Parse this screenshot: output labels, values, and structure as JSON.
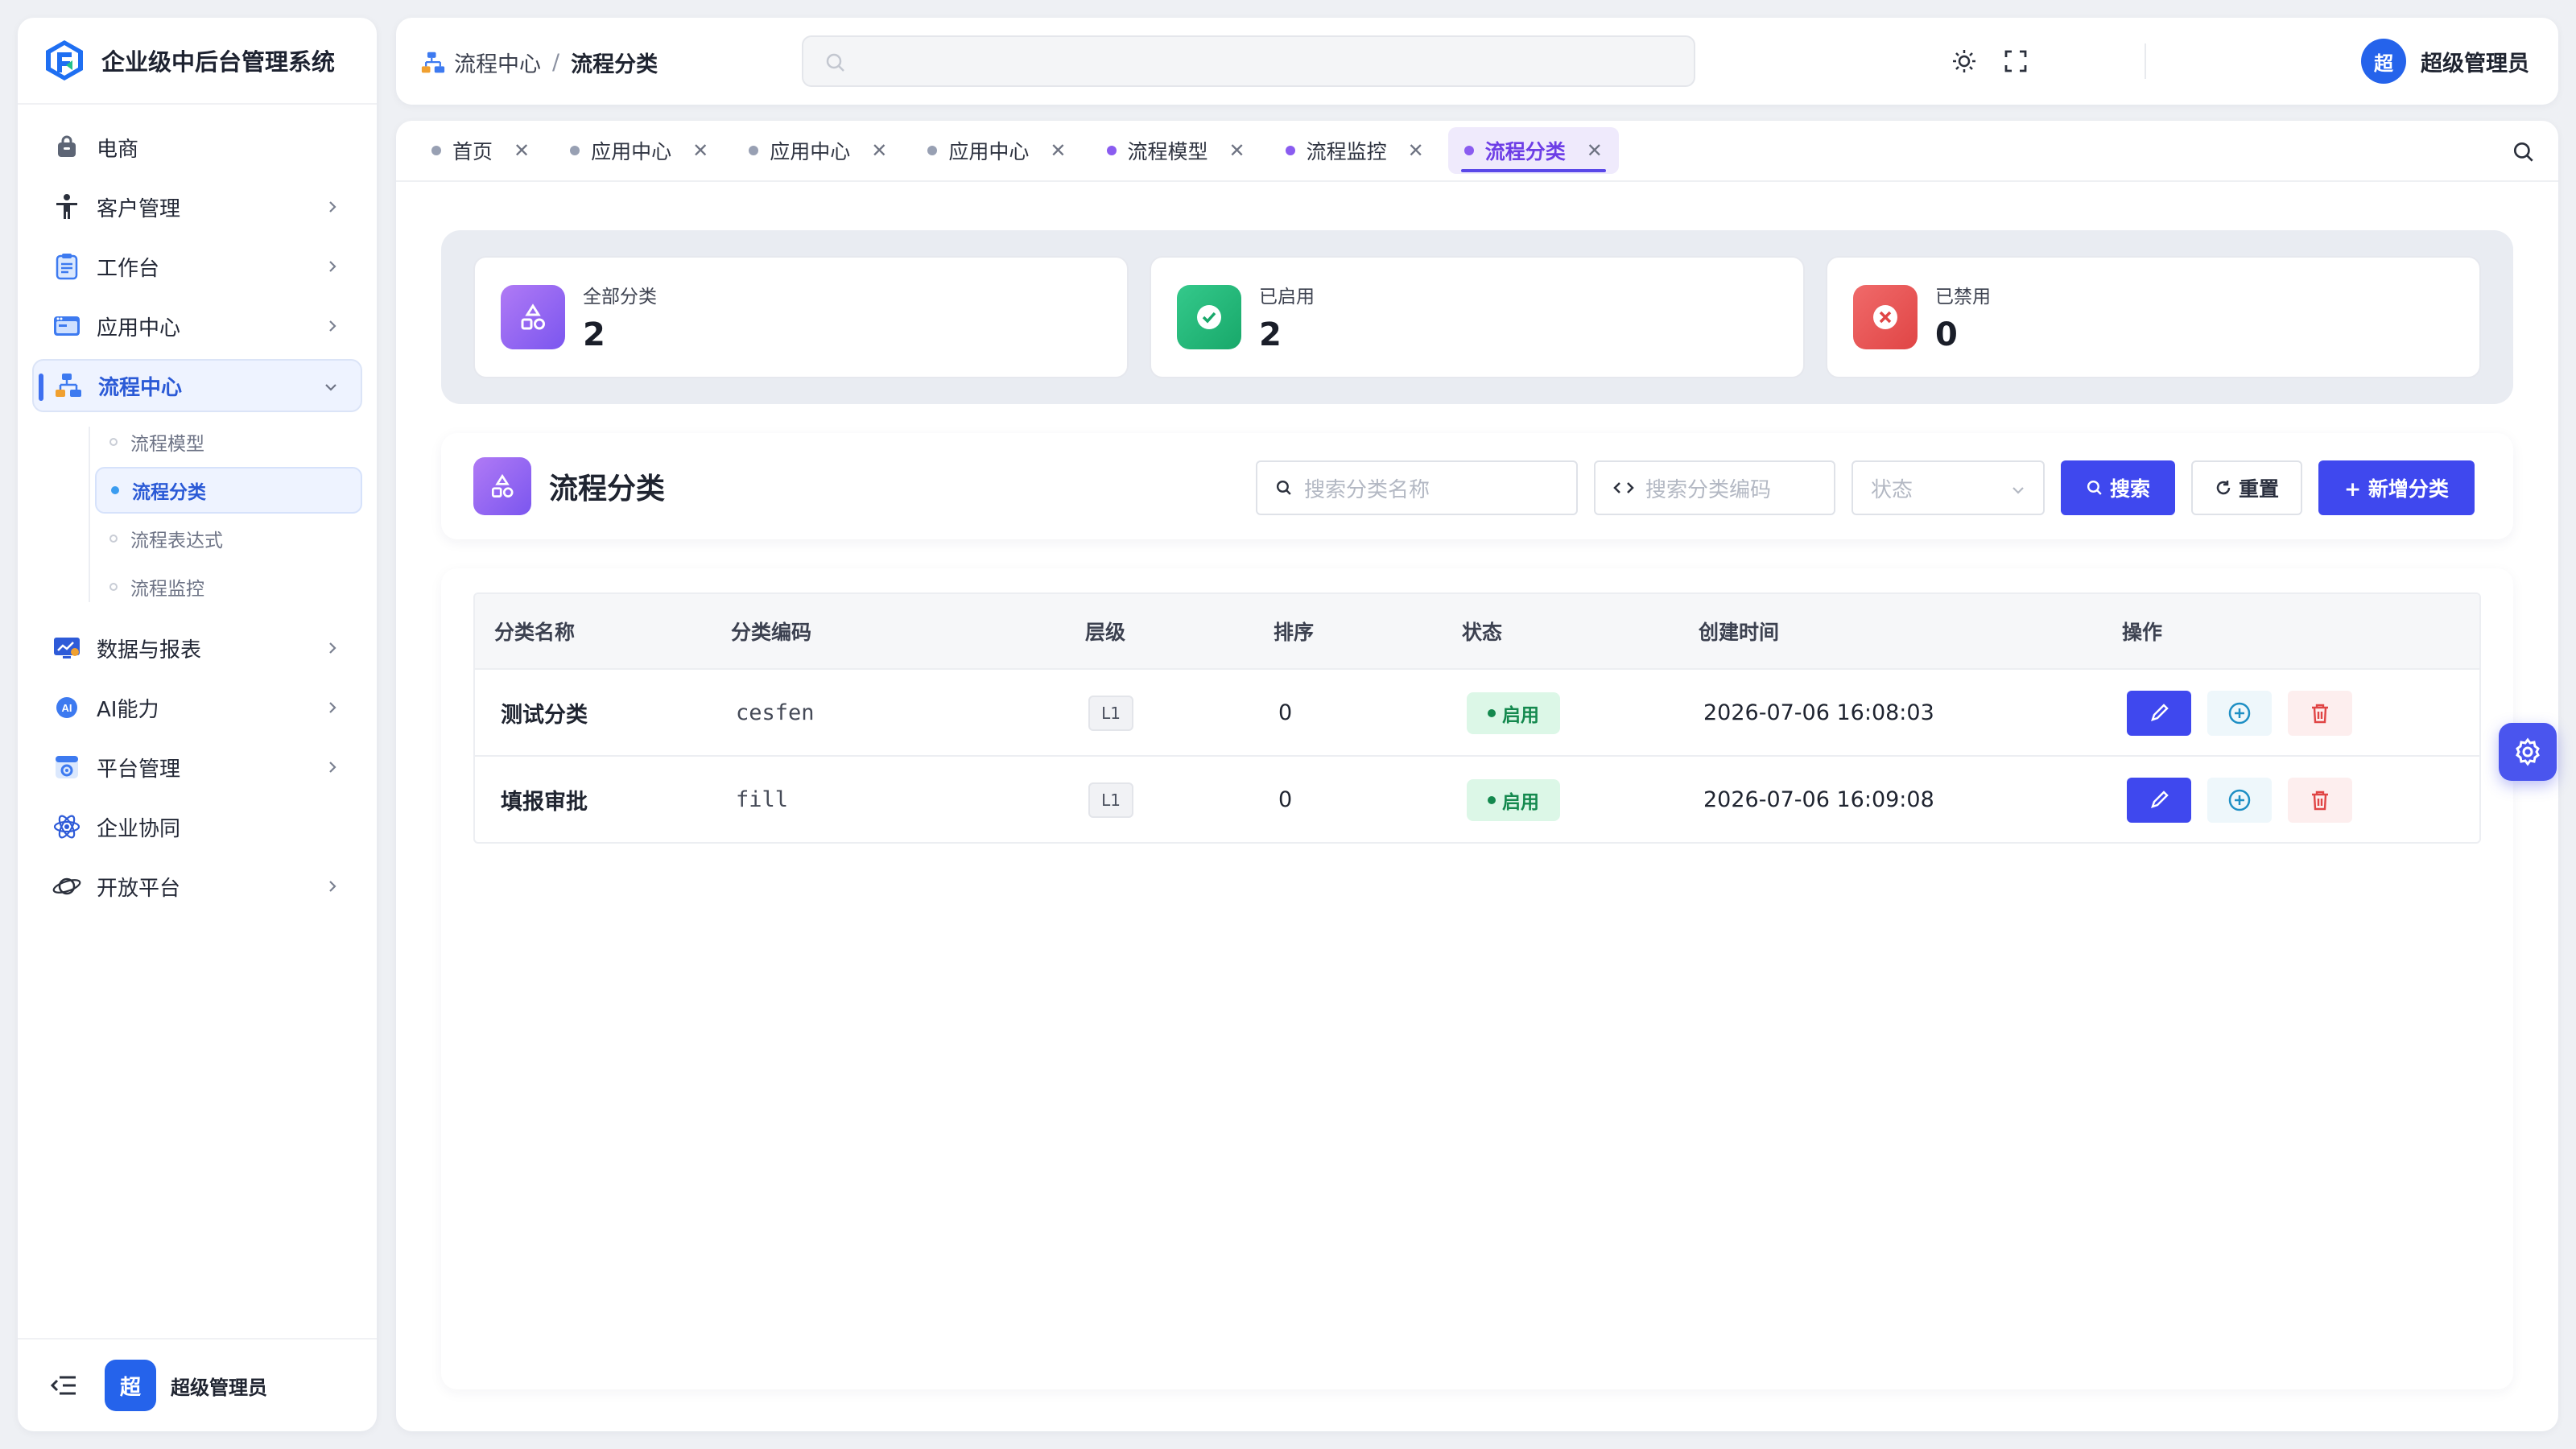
{
  "app": {
    "title": "企业级中后台管理系统"
  },
  "sidebar": {
    "items": [
      {
        "label": "电商",
        "icon": "shopping-bag-icon",
        "has_children": false
      },
      {
        "label": "客户管理",
        "icon": "person-icon",
        "has_children": true
      },
      {
        "label": "工作台",
        "icon": "clipboard-icon",
        "has_children": true
      },
      {
        "label": "应用中心",
        "icon": "app-window-icon",
        "has_children": true
      },
      {
        "label": "流程中心",
        "icon": "flow-icon",
        "has_children": true,
        "expanded": true,
        "active": true
      },
      {
        "label": "数据与报表",
        "icon": "chart-monitor-icon",
        "has_children": true
      },
      {
        "label": "AI能力",
        "icon": "ai-icon",
        "has_children": true
      },
      {
        "label": "平台管理",
        "icon": "platform-gear-icon",
        "has_children": true
      },
      {
        "label": "企业协同",
        "icon": "atom-icon",
        "has_children": false
      },
      {
        "label": "开放平台",
        "icon": "planet-icon",
        "has_children": true
      }
    ],
    "subitems": [
      {
        "label": "流程模型",
        "active": false
      },
      {
        "label": "流程分类",
        "active": true
      },
      {
        "label": "流程表达式",
        "active": false
      },
      {
        "label": "流程监控",
        "active": false
      }
    ],
    "footer": {
      "avatar_text": "超",
      "user_name": "超级管理员"
    }
  },
  "header": {
    "breadcrumb": {
      "parent": "流程中心",
      "separator": "/",
      "current": "流程分类"
    },
    "search_placeholder": "",
    "user": {
      "avatar_text": "超",
      "name": "超级管理员"
    }
  },
  "tabs": [
    {
      "label": "首页",
      "active": false,
      "dot": "gray"
    },
    {
      "label": "应用中心",
      "active": false,
      "dot": "gray"
    },
    {
      "label": "应用中心",
      "active": false,
      "dot": "gray"
    },
    {
      "label": "应用中心",
      "active": false,
      "dot": "gray"
    },
    {
      "label": "流程模型",
      "active": false,
      "dot": "purple"
    },
    {
      "label": "流程监控",
      "active": false,
      "dot": "purple"
    },
    {
      "label": "流程分类",
      "active": true,
      "dot": "purple"
    }
  ],
  "stats": [
    {
      "label": "全部分类",
      "value": "2",
      "color": "#8b5cf6"
    },
    {
      "label": "已启用",
      "value": "2",
      "color": "#22b374"
    },
    {
      "label": "已禁用",
      "value": "0",
      "color": "#ea5455"
    }
  ],
  "toolbar": {
    "title": "流程分类",
    "name_placeholder": "搜索分类名称",
    "code_placeholder": "搜索分类编码",
    "status_placeholder": "状态",
    "search_label": "搜索",
    "reset_label": "重置",
    "add_label": "+ 新增分类"
  },
  "table": {
    "columns": [
      "分类名称",
      "分类编码",
      "层级",
      "排序",
      "状态",
      "创建时间",
      "操作"
    ],
    "rows": [
      {
        "name": "测试分类",
        "code": "cesfen",
        "level": "L1",
        "sort": "0",
        "status": "启用",
        "created": "2026-07-06 16:08:03"
      },
      {
        "name": "填报审批",
        "code": "fill",
        "level": "L1",
        "sort": "0",
        "status": "启用",
        "created": "2026-07-06 16:09:08"
      }
    ]
  },
  "colors": {
    "primary": "#3f48ee",
    "accent_purple": "#6d3ee6",
    "success": "#14894e",
    "danger": "#e04545"
  }
}
